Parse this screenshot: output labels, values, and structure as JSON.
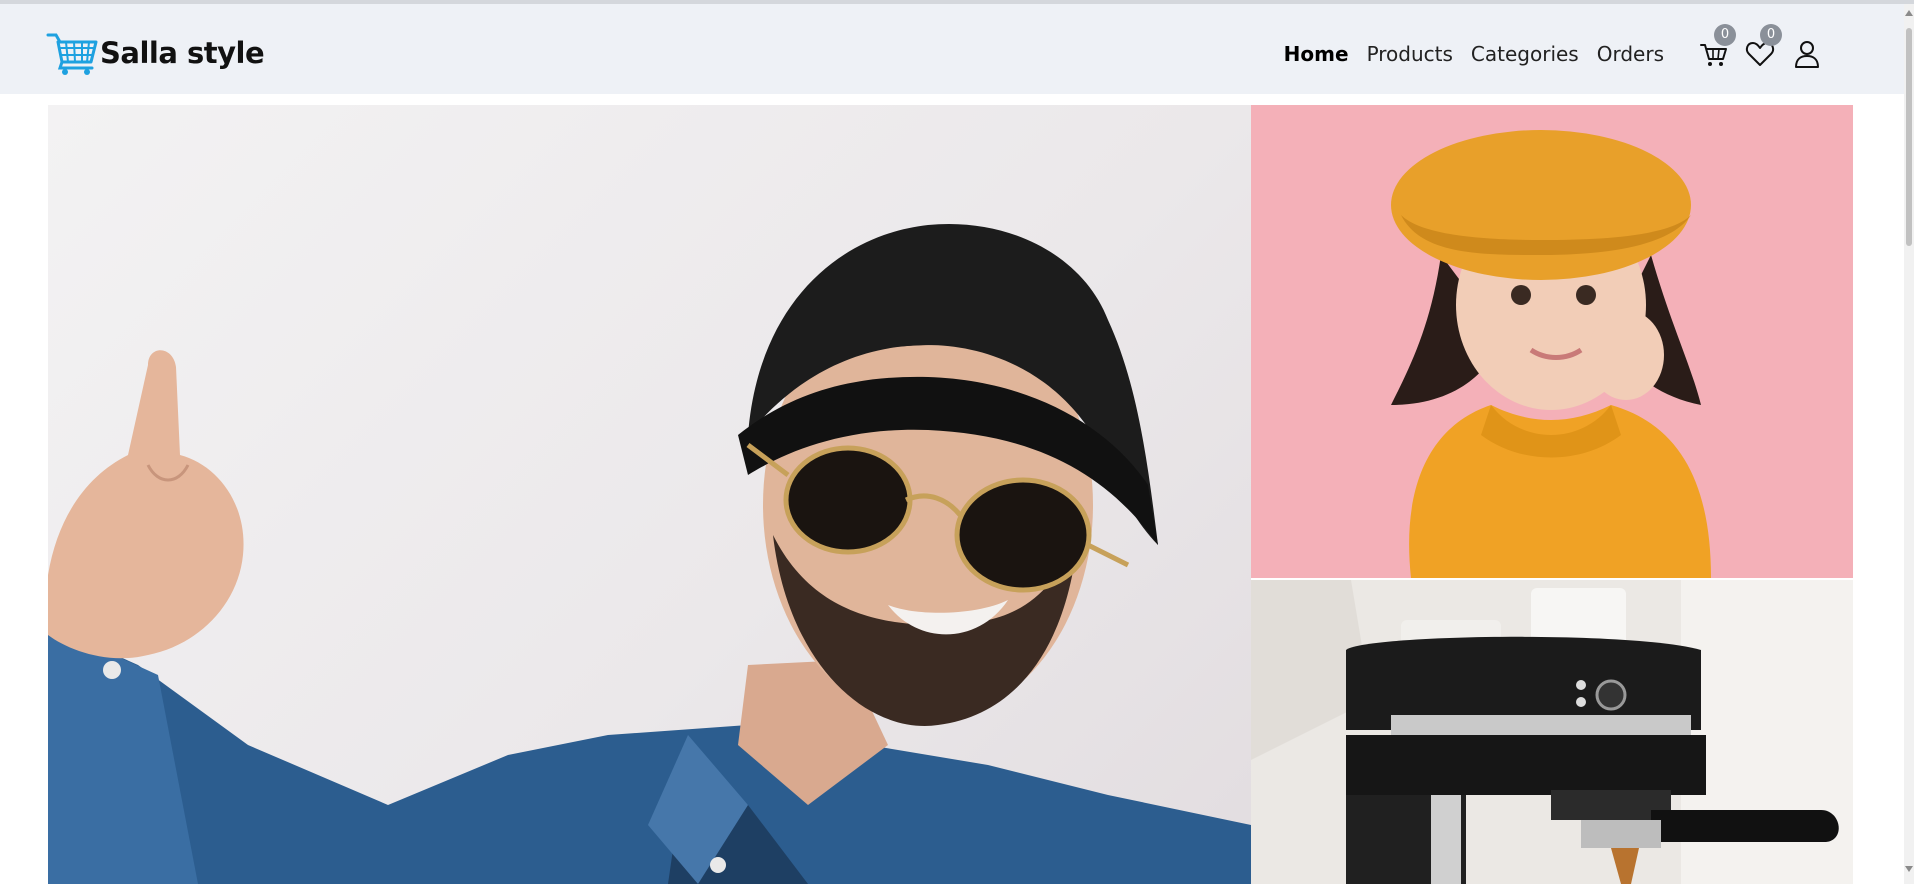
{
  "brand": {
    "name": "Salla style",
    "logo_icon": "shopping-cart-icon",
    "logo_color": "#1ea1e0"
  },
  "nav": {
    "items": [
      {
        "label": "Home",
        "active": true
      },
      {
        "label": "Products",
        "active": false
      },
      {
        "label": "Categories",
        "active": false
      },
      {
        "label": "Orders",
        "active": false
      }
    ]
  },
  "header_icons": {
    "cart": {
      "icon": "cart-icon",
      "count": "0"
    },
    "wishlist": {
      "icon": "heart-icon",
      "count": "0"
    },
    "account": {
      "icon": "user-icon"
    }
  },
  "hero": {
    "main_image": "man-with-hat-and-sunglasses",
    "top_right_image": "girl-in-orange-beret-and-sweater",
    "bottom_right_image": "espresso-machine"
  },
  "colors": {
    "navbar_bg": "#eef1f6",
    "badge_bg": "#8a9099",
    "brand_blue": "#1ea1e0"
  }
}
